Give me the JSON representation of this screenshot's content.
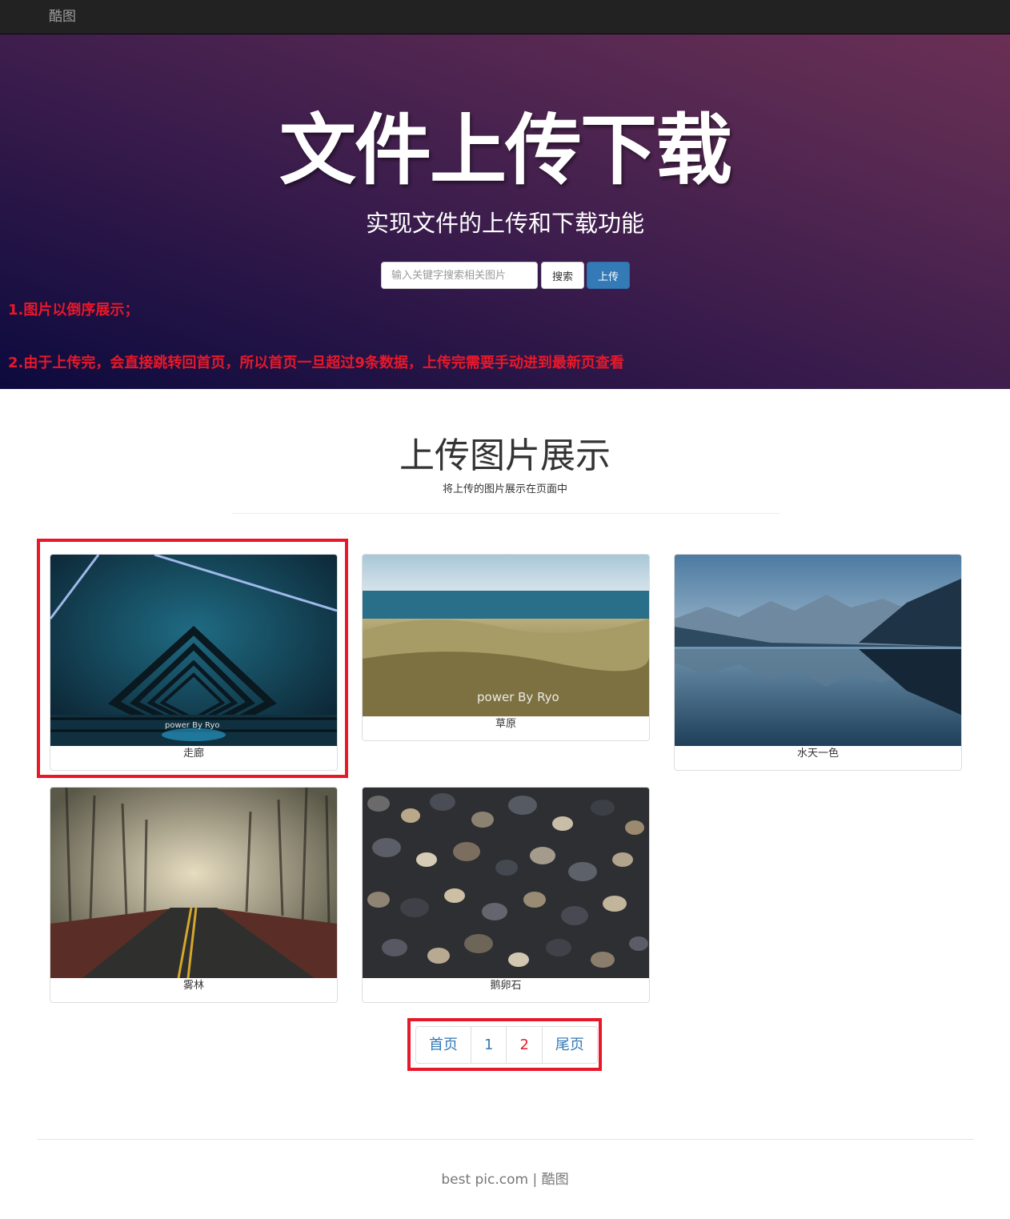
{
  "navbar": {
    "brand": "酷图"
  },
  "hero": {
    "title": "文件上传下载",
    "subtitle": "实现文件的上传和下载功能",
    "search_placeholder": "输入关键字搜索相关图片",
    "search_label": "搜索",
    "upload_label": "上传",
    "notes": [
      "1.图片以倒序展示；",
      "2.由于上传完，会直接跳转回首页，所以首页一旦超过9条数据，上传完需要手动进到最新页查看"
    ]
  },
  "gallery": {
    "title": "上传图片展示",
    "subtitle": "将上传的图片展示在页面中",
    "items": [
      {
        "caption": "走廊",
        "icon": "corridor-photo",
        "watermark": "power By Ryo"
      },
      {
        "caption": "草原",
        "icon": "grassland-photo",
        "watermark": "power By Ryo"
      },
      {
        "caption": "水天一色",
        "icon": "lake-photo"
      },
      {
        "caption": "雾林",
        "icon": "foggy-forest-photo"
      },
      {
        "caption": "鹅卵石",
        "icon": "pebbles-photo"
      }
    ]
  },
  "pagination": {
    "first": "首页",
    "pages": [
      "1",
      "2"
    ],
    "current": "2",
    "last": "尾页"
  },
  "footer": {
    "text": "best pic.com | 酷图"
  },
  "colors": {
    "highlight": "#e8182a",
    "link": "#337ab7",
    "navbar": "#222222"
  }
}
